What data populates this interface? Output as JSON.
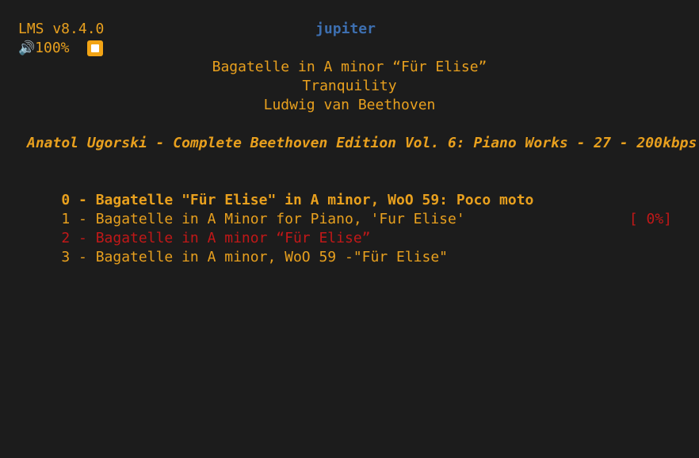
{
  "header": {
    "app_version": "LMS v8.4.0",
    "hostname": "jupiter",
    "volume": "100%",
    "volume_icon": "speaker-icon",
    "stop_icon": "stop-icon"
  },
  "now_playing": {
    "title": "Bagatelle in A minor “Für Elise”",
    "album": "Tranquility",
    "artist": "Ludwig van Beethoven"
  },
  "album_header": "Anatol Ugorski - Complete Beethoven Edition Vol. 6: Piano Works - 27 - 200kbps",
  "tracks": [
    {
      "label": "0 - Bagatelle \"Für Elise\" in A minor, WoO 59: Poco moto"
    },
    {
      "label": "1 - Bagatelle in A Minor for Piano, 'Fur Elise'"
    },
    {
      "label": "2 - Bagatelle in A minor “Für Elise”",
      "progress": "[ 0%]"
    },
    {
      "label": "3 - Bagatelle in A minor, WoO 59 -\"Für Elise\""
    }
  ],
  "colors": {
    "background": "#1c1c1c",
    "text": "#e8a01e",
    "hostname": "#3d6fb0",
    "playing": "#c21818"
  }
}
